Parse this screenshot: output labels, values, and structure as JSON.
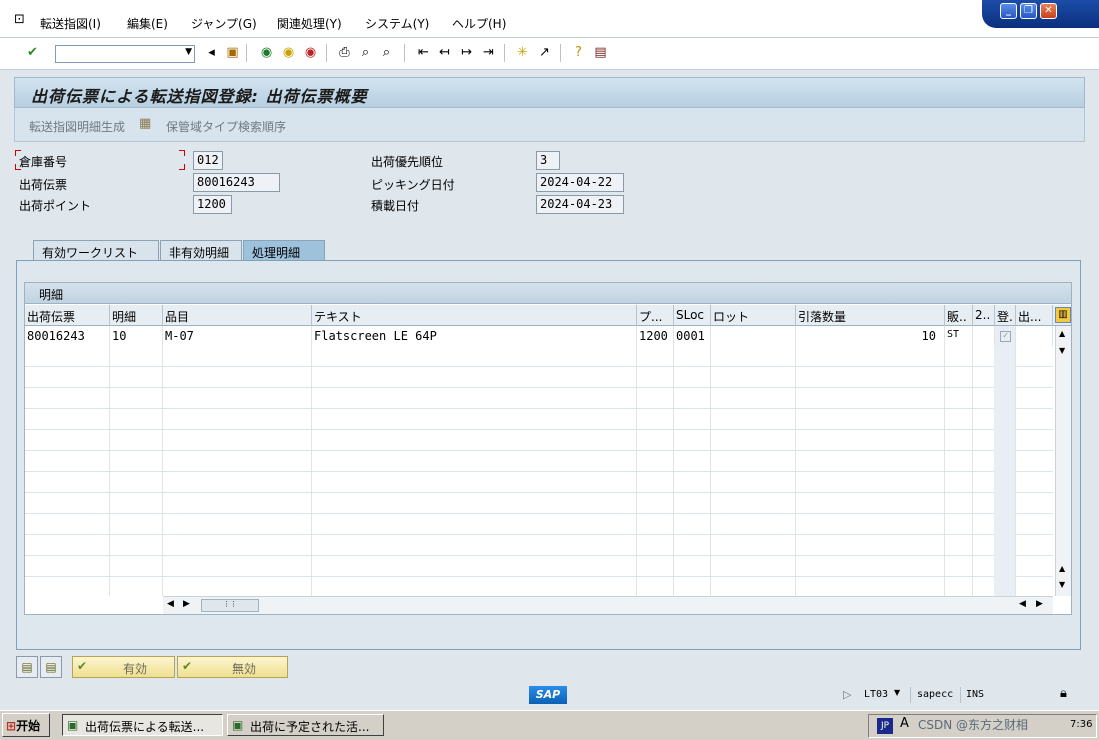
{
  "menu": [
    "転送指図(I)",
    "編集(E)",
    "ジャンプ(G)",
    "関連処理(Y)",
    "システム(Y)",
    "ヘルプ(H)"
  ],
  "title": "出荷伝票による転送指図登録: 出荷伝票概要",
  "app_toolbar": {
    "btn1": "転送指図明細生成",
    "btn2": "保管域タイプ検索順序"
  },
  "fields": {
    "warehouse_label": "倉庫番号",
    "warehouse_value": "012",
    "delivery_label": "出荷伝票",
    "delivery_value": "80016243",
    "shipping_point_label": "出荷ポイント",
    "shipping_point_value": "1200",
    "priority_label": "出荷優先順位",
    "priority_value": "3",
    "picking_date_label": "ピッキング日付",
    "picking_date_value": "2024-04-22",
    "loading_date_label": "積載日付",
    "loading_date_value": "2024-04-23"
  },
  "tabs": [
    "有効ワークリスト",
    "非有効明細",
    "処理明細"
  ],
  "table": {
    "title": "明細",
    "headers": [
      "出荷伝票",
      "明細",
      "品目",
      "テキスト",
      "プ...",
      "SLoc",
      "ロット",
      "引落数量",
      "販..",
      "2..",
      "登.",
      "出..."
    ],
    "rows": [
      [
        "80016243",
        "10",
        "M-07",
        "Flatscreen LE 64P",
        "1200",
        "0001",
        "",
        "10",
        "ST",
        "",
        "",
        ""
      ]
    ]
  },
  "bottom_buttons": {
    "valid": "有効",
    "invalid": "無効"
  },
  "status": {
    "tcode": "LT03",
    "server": "sapecc",
    "mode": "INS",
    "sap_logo": "SAP"
  },
  "taskbar": {
    "start": "开始",
    "task1": "出荷伝票による転送...",
    "task2": "出荷に予定された活...",
    "lang": "JP",
    "watermark": "CSDN @东方之财相",
    "clock": "7:36"
  }
}
